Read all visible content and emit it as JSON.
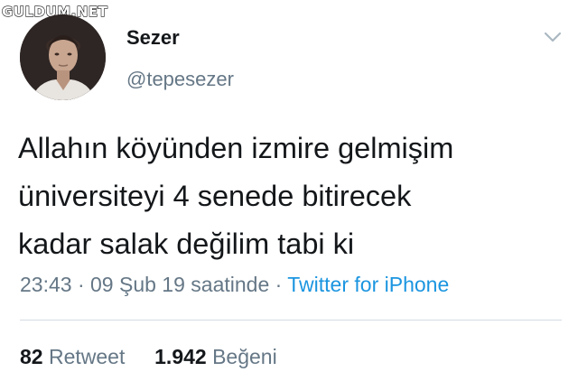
{
  "watermark": "GULDUM.NET",
  "tweet": {
    "display_name": "Sezer",
    "handle": "@tepesezer",
    "text": "Allahın köyünden izmire gelmişim\nüniversiteyi 4 senede bitirecek\nkadar salak değilim tabi ki",
    "time": "23:43",
    "date": "09 Şub 19 saatinde",
    "separator": "·",
    "source": "Twitter for iPhone",
    "retweet_count": "82",
    "retweet_label": "Retweet",
    "like_count": "1.942",
    "like_label": "Beğeni"
  },
  "icons": {
    "menu": "chevron-down-icon",
    "avatar": "profile-photo"
  },
  "colors": {
    "text": "#14171a",
    "secondary": "#657786",
    "link": "#1b95e0",
    "divider": "#d6dde3"
  }
}
